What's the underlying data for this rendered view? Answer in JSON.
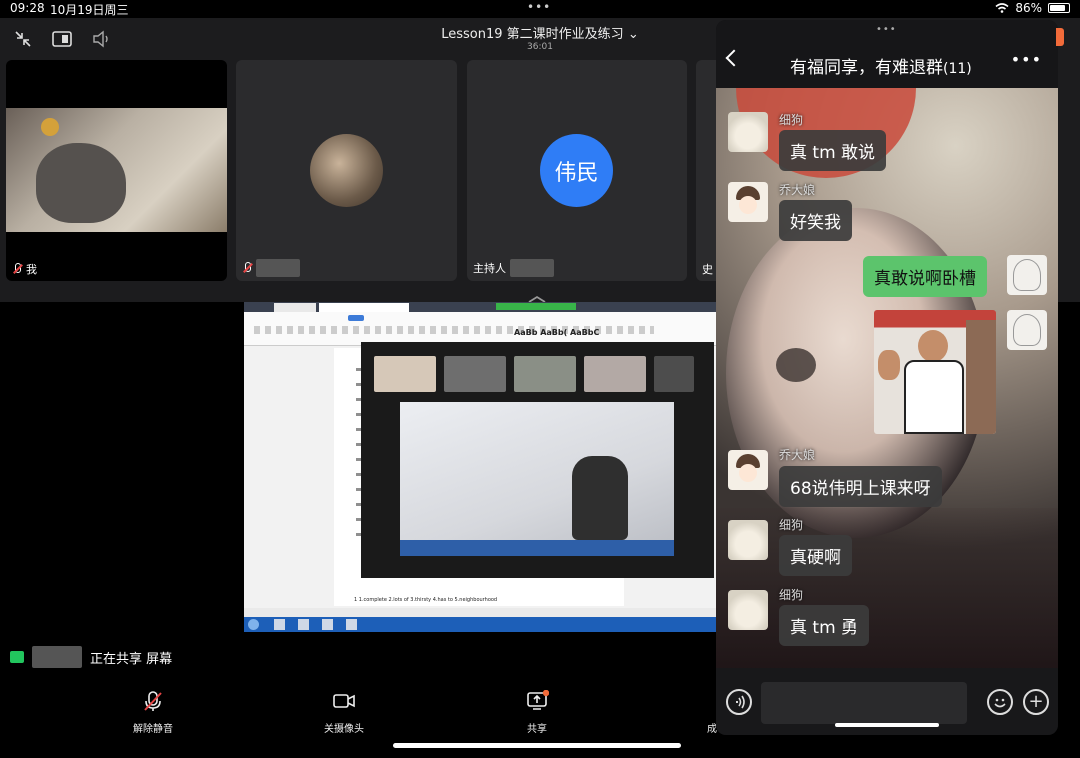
{
  "status_bar": {
    "time": "09:28",
    "date": "10月19日周三",
    "battery": "86%",
    "battery_level": 0.86
  },
  "meeting": {
    "title": "Lesson19 第二课时作业及练习",
    "timer": "36:01"
  },
  "tiles": [
    {
      "label": "我"
    },
    {
      "label": ""
    },
    {
      "label": "主持人",
      "avatar_text": "伟民",
      "avatar_color": "#2f7df6"
    },
    {
      "label": "史"
    }
  ],
  "sharing": {
    "status": "正在共享 屏幕",
    "doc_bottom_line": "1 1.complete    2.lots of    3.thirsty    4.has to    5.neighbourhood"
  },
  "toolbar": {
    "unmute": "解除静音",
    "camera_off": "关摄像头",
    "share": "共享",
    "members_partial": "成"
  },
  "chat": {
    "title": "有福同享，有难退群",
    "count": "(11)",
    "messages": [
      {
        "sender": "细狗",
        "text": "真 tm 敢说"
      },
      {
        "sender": "乔大娘",
        "text": "好笑我"
      },
      {
        "sender": "",
        "text": "真敢说啊卧槽"
      },
      {
        "sender": "乔大娘",
        "text": "68说伟明上课来呀"
      },
      {
        "sender": "细狗",
        "text": "真硬啊"
      },
      {
        "sender": "细狗",
        "text": "真 tm 勇"
      }
    ]
  },
  "colors": {
    "accent_green": "#5cc46c",
    "avatar_blue": "#2f7df6",
    "notify_dot": "#f26b3a"
  }
}
